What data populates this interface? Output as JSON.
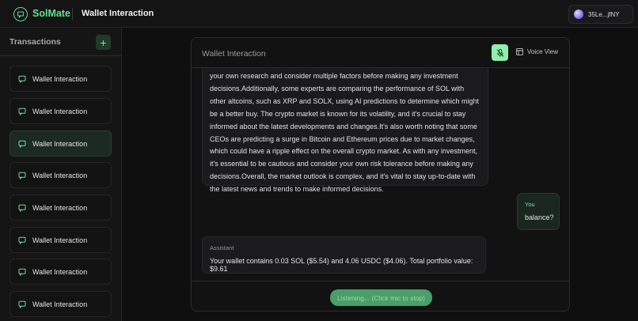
{
  "app": {
    "brand": "SolMate",
    "window_title": "Wallet Interaction",
    "wallet_address": "35Le...jfNY",
    "brand_color": "#66e08e"
  },
  "sidebar": {
    "title": "Transactions",
    "add_label": "+",
    "items": [
      {
        "label": "Wallet Interaction",
        "active": false
      },
      {
        "label": "Wallet Interaction",
        "active": false
      },
      {
        "label": "Wallet Interaction",
        "active": true
      },
      {
        "label": "Wallet Interaction",
        "active": false
      },
      {
        "label": "Wallet Interaction",
        "active": false
      },
      {
        "label": "Wallet Interaction",
        "active": false
      },
      {
        "label": "Wallet Interaction",
        "active": false
      },
      {
        "label": "Wallet Interaction",
        "active": false
      }
    ]
  },
  "panel": {
    "title": "Wallet Interaction",
    "voice_view_label": "Voice View",
    "messages": [
      {
        "role": "assistant",
        "text": "your own research and consider multiple factors before making any investment decisions.Additionally, some experts are comparing the performance of SOL with other altcoins, such as XRP and SOLX, using AI predictions to determine which might be a better buy. The crypto market is known for its volatility, and it's crucial to stay informed about the latest developments and changes.It's also worth noting that some CEOs are predicting a surge in Bitcoin and Ethereum prices due to market changes, which could have a ripple effect on the overall crypto market. As with any investment, it's essential to be cautious and consider your own risk tolerance before making any decisions.Overall, the market outlook is complex, and it's vital to stay up-to-date with the latest news and trends to make informed decisions."
      },
      {
        "role": "user",
        "label": "You",
        "text": "balance?"
      },
      {
        "role": "assistant",
        "label": "Assistant",
        "text": "Your wallet contains 0.03 SOL ($5.54) and 4.06 USDC ($4.06). Total portfolio value: $9.61"
      }
    ],
    "listen_button_label": "Listening... (Click mic to stop)"
  }
}
